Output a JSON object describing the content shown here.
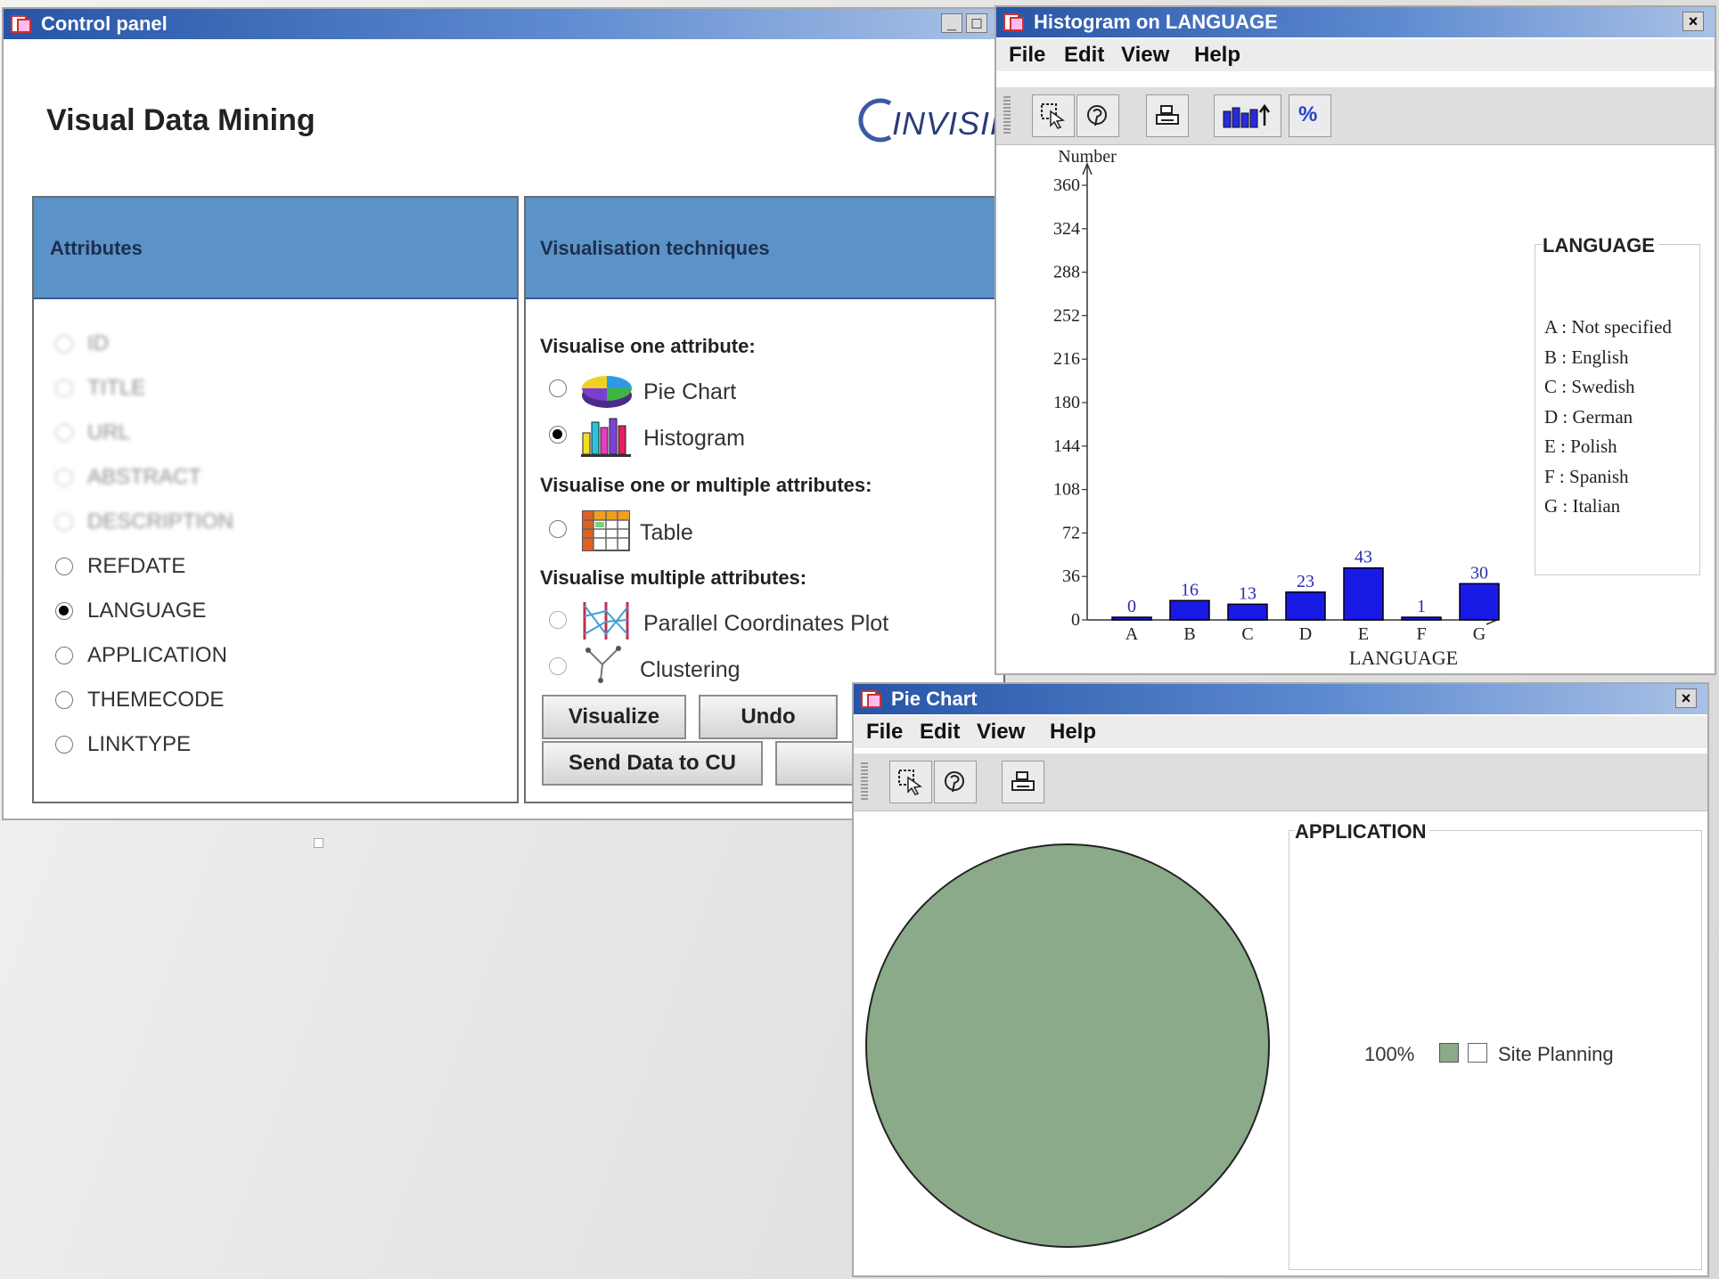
{
  "control_panel": {
    "title": "Control panel",
    "heading": "Visual Data Mining",
    "logo_text": "INVISIP",
    "attributes_header": "Attributes",
    "techniques_header": "Visualisation techniques",
    "attributes": [
      {
        "label": "ID",
        "state": "disabled"
      },
      {
        "label": "TITLE",
        "state": "disabled"
      },
      {
        "label": "URL",
        "state": "disabled"
      },
      {
        "label": "ABSTRACT",
        "state": "disabled"
      },
      {
        "label": "DESCRIPTION",
        "state": "disabled"
      },
      {
        "label": "REFDATE",
        "state": "unselected"
      },
      {
        "label": "LANGUAGE",
        "state": "selected"
      },
      {
        "label": "APPLICATION",
        "state": "unselected"
      },
      {
        "label": "THEMECODE",
        "state": "unselected"
      },
      {
        "label": "LINKTYPE",
        "state": "unselected"
      }
    ],
    "one_attr_title": "Visualise one attribute:",
    "opt_pie": "Pie Chart",
    "opt_histogram": "Histogram",
    "selected_technique": "Histogram",
    "one_or_multi_title": "Visualise one or multiple attributes:",
    "opt_table": "Table",
    "multi_title": "Visualise multiple attributes:",
    "opt_parallel": "Parallel Coordinates Plot",
    "opt_clustering": "Clustering",
    "btn_visualize": "Visualize",
    "btn_undo": "Undo",
    "btn_send": "Send Data to CU"
  },
  "histogram_window": {
    "title": "Histogram on LANGUAGE",
    "menu": [
      "File",
      "Edit",
      "View",
      "Help"
    ],
    "toolbar_icons": [
      "select-icon",
      "zoom-icon",
      "print-icon",
      "bar-sort-icon",
      "percent-icon"
    ],
    "percent_label": "%",
    "legend_title": "LANGUAGE",
    "legend": [
      "A : Not specified",
      "B : English",
      "C : Swedish",
      "D : German",
      "E : Polish",
      "F : Spanish",
      "G : Italian"
    ]
  },
  "pie_window": {
    "title": "Pie Chart",
    "menu": [
      "File",
      "Edit",
      "View",
      "Help"
    ],
    "toolbar_icons": [
      "select-icon",
      "zoom-icon",
      "print-icon"
    ],
    "legend_title": "APPLICATION",
    "legend_percent": "100%",
    "legend_label": "Site Planning"
  },
  "colors": {
    "title_bar": "#2754a6",
    "header_bar": "#5b93c9",
    "bar_fill": "#1a1ae6",
    "pie_fill": "#8aaa8a"
  },
  "chart_data": [
    {
      "type": "bar",
      "title": "",
      "xlabel": "LANGUAGE",
      "ylabel": "Number",
      "categories": [
        "A",
        "B",
        "C",
        "D",
        "E",
        "F",
        "G"
      ],
      "values": [
        0,
        16,
        13,
        23,
        43,
        1,
        30
      ],
      "yticks": [
        0,
        36,
        72,
        108,
        144,
        180,
        216,
        252,
        288,
        324,
        360
      ],
      "ylim": [
        0,
        360
      ],
      "grid": false,
      "legend_position": "right"
    },
    {
      "type": "pie",
      "title": "",
      "categories": [
        "Site Planning"
      ],
      "values": [
        100
      ],
      "legend_position": "right"
    }
  ]
}
